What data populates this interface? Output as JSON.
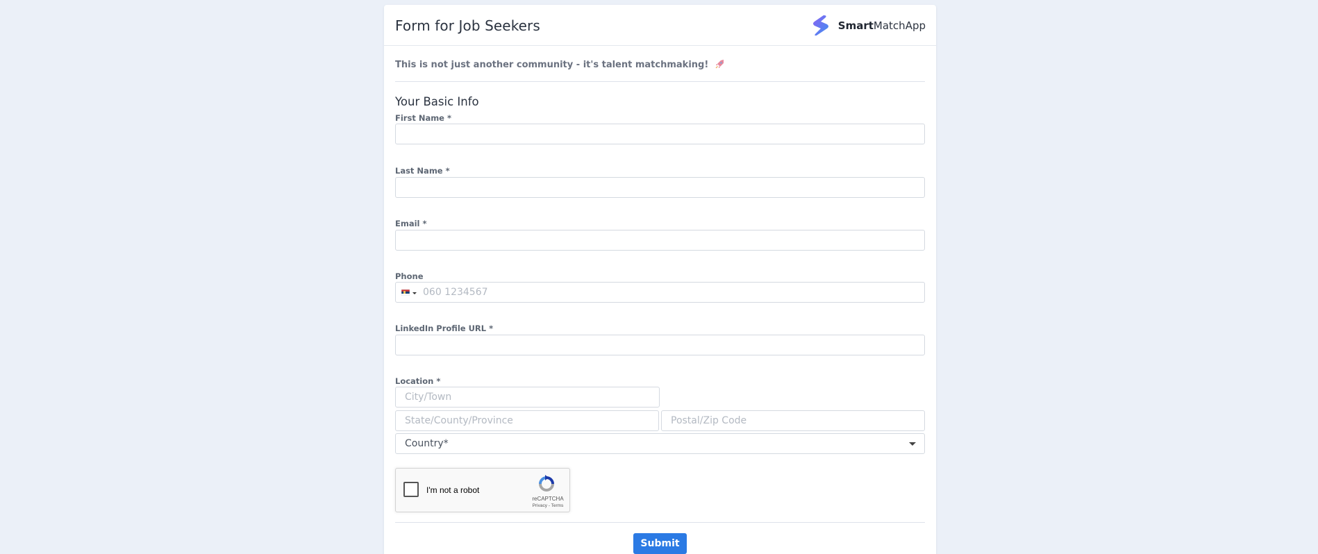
{
  "header": {
    "form_title": "Form for Job Seekers",
    "brand_bold": "Smart",
    "brand_rest": "MatchApp"
  },
  "tagline": "This is not just another community - it's talent matchmaking! ",
  "section_title": "Your Basic Info",
  "fields": {
    "first_name": {
      "label": "First Name",
      "required": "*",
      "value": ""
    },
    "last_name": {
      "label": "Last Name",
      "required": "*",
      "value": ""
    },
    "email": {
      "label": "Email",
      "required": "*",
      "value": ""
    },
    "phone": {
      "label": "Phone",
      "placeholder": "060 1234567",
      "country_flag": "Serbia"
    },
    "linkedin": {
      "label": "LinkedIn Profile URL",
      "required": "*",
      "value": ""
    },
    "location": {
      "label": "Location",
      "required": "*",
      "city_placeholder": "City/Town",
      "state_placeholder": "State/County/Province",
      "postal_placeholder": "Postal/Zip Code",
      "country_selected": "Country*"
    }
  },
  "captcha": {
    "label": "I'm not a robot",
    "brand": "reCAPTCHA",
    "privacy": "Privacy",
    "separator": " - ",
    "terms": "Terms"
  },
  "submit_label": "Submit",
  "colors": {
    "background": "#ebf0f8",
    "accent": "#2b7ae4",
    "logo_gradient_start": "#7b5cf0",
    "logo_gradient_end": "#3d8ef0"
  },
  "icons": {
    "brand_logo": "smartmatch-s-logo",
    "tagline_emoji": "rocket-icon",
    "captcha_logo": "recaptcha-icon"
  }
}
